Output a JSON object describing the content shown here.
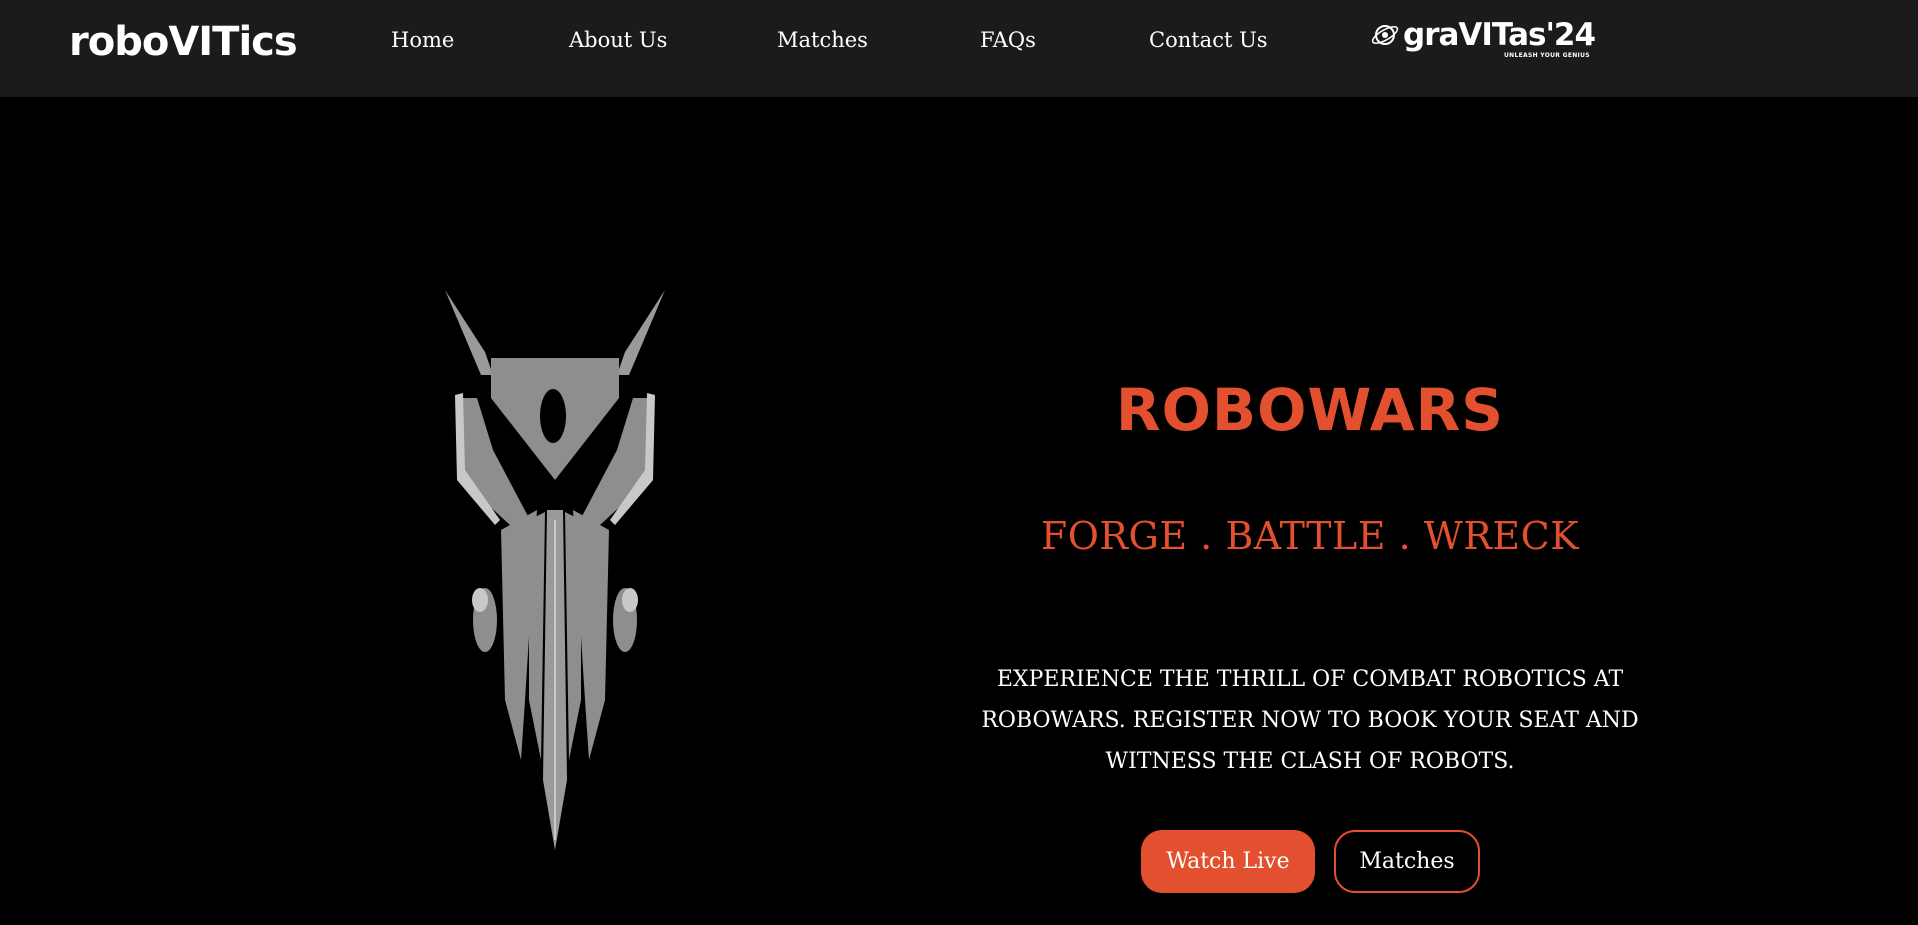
{
  "header": {
    "brand": "roboVITics",
    "nav": [
      {
        "label": "Home"
      },
      {
        "label": "About Us"
      },
      {
        "label": "Matches"
      },
      {
        "label": "FAQs"
      },
      {
        "label": "Contact Us"
      }
    ],
    "partner": {
      "name": "graVITas'24",
      "tagline": "UNLEASH YOUR GENIUS",
      "icon": "planet-logo-icon"
    }
  },
  "hero": {
    "mascot_icon": "robot-emblem-icon",
    "title": "ROBOWARS",
    "tagline": "FORGE . BATTLE . WRECK",
    "description": "Experience the thrill of combat robotics at RoboWars. Register now to book your seat and witness the clash of robots.",
    "buttons": {
      "primary": "Watch Live",
      "secondary": "Matches"
    }
  },
  "colors": {
    "accent": "#e3502f",
    "navbar_bg": "#1b1b1b",
    "page_bg": "#000000",
    "emblem": "#8e8e8e"
  }
}
